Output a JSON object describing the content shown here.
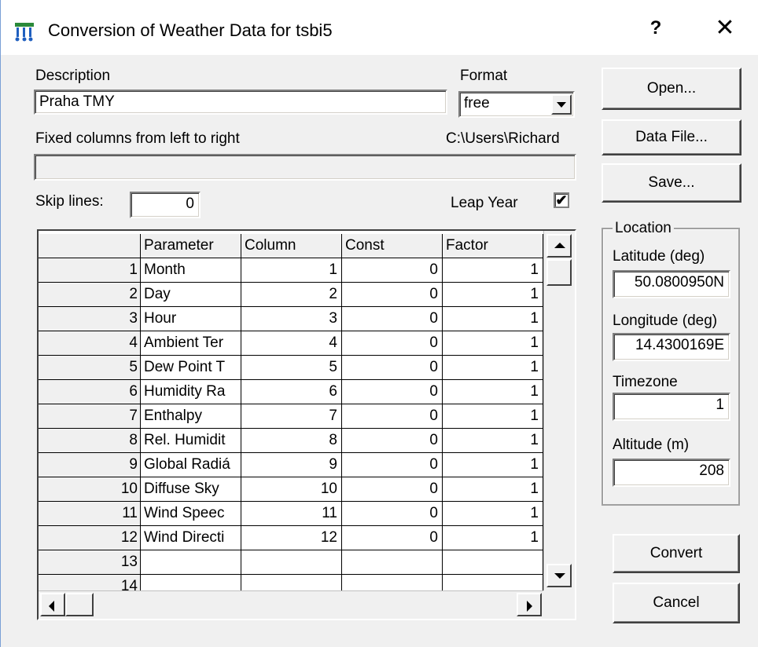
{
  "window": {
    "title": "Conversion of Weather Data for tsbi5",
    "help_label": "?",
    "close_label": "✕",
    "app_icon": "weather-app-icon"
  },
  "description": {
    "label": "Description",
    "value": "Praha TMY"
  },
  "format": {
    "label": "Format",
    "selected": "free"
  },
  "fixed_columns": {
    "label": "Fixed columns from left to right",
    "value": ""
  },
  "path_text": "C:\\Users\\Richard",
  "skip_lines": {
    "label": "Skip lines:",
    "value": "0"
  },
  "leap_year": {
    "label": "Leap Year",
    "checked": true,
    "check_glyph": "✔"
  },
  "buttons": {
    "open": "Open...",
    "data_file": "Data File...",
    "save": "Save...",
    "convert": "Convert",
    "cancel": "Cancel"
  },
  "location": {
    "title": "Location",
    "latitude_label": "Latitude (deg)",
    "latitude_value": "50.0800950N",
    "longitude_label": "Longitude (deg)",
    "longitude_value": "14.4300169E",
    "timezone_label": "Timezone",
    "timezone_value": "1",
    "altitude_label": "Altitude (m)",
    "altitude_value": "208"
  },
  "table": {
    "headers": [
      "",
      "Parameter",
      "Column",
      "Const",
      "Factor"
    ],
    "rows": [
      [
        "1",
        "Month",
        "1",
        "0",
        "1"
      ],
      [
        "2",
        "Day",
        "2",
        "0",
        "1"
      ],
      [
        "3",
        "Hour",
        "3",
        "0",
        "1"
      ],
      [
        "4",
        "Ambient Ter",
        "4",
        "0",
        "1"
      ],
      [
        "5",
        "Dew Point T",
        "5",
        "0",
        "1"
      ],
      [
        "6",
        "Humidity Ra",
        "6",
        "0",
        "1"
      ],
      [
        "7",
        "Enthalpy",
        "7",
        "0",
        "1"
      ],
      [
        "8",
        "Rel. Humidit",
        "8",
        "0",
        "1"
      ],
      [
        "9",
        "Global Radiá",
        "9",
        "0",
        "1"
      ],
      [
        "10",
        "Diffuse Sky",
        "10",
        "0",
        "1"
      ],
      [
        "11",
        "Wind Speec",
        "11",
        "0",
        "1"
      ],
      [
        "12",
        "Wind Directi",
        "12",
        "0",
        "1"
      ],
      [
        "13",
        "",
        "",
        "",
        ""
      ],
      [
        "14",
        "",
        "",
        "",
        ""
      ]
    ]
  },
  "colors": {
    "dialog_bg": "#f0f0f0",
    "field_bg": "#ffffff",
    "icon_blue": "#1f5fbf",
    "icon_green": "#2a8a3a"
  }
}
